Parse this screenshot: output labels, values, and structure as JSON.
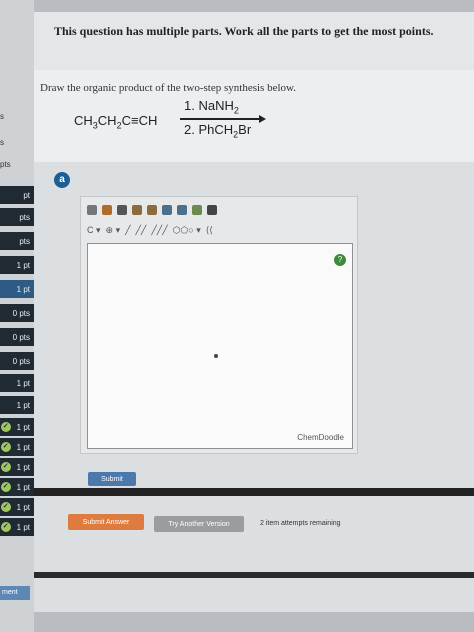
{
  "header": {
    "title": "This question has multiple parts. Work all the parts to get the most points."
  },
  "question": {
    "prompt": "Draw the organic product of the two-step synthesis below.",
    "reactant": "CH3CH2C≡CH",
    "step1": "1. NaNH2",
    "step2": "2. PhCH2Br"
  },
  "part": {
    "label": "a"
  },
  "editor": {
    "brand": "ChemDoodle",
    "submit_label": "Submit"
  },
  "actions": {
    "submit_answer_label": "Submit Answer",
    "try_version_label": "Try Another Version",
    "attempts_text": "2 item attempts remaining"
  },
  "sidebar": {
    "items": [
      "pt",
      "pts",
      "pts",
      "1 pt",
      "1 pt",
      "0 pts",
      "0 pts",
      "0 pts",
      "1 pt",
      "1 pt",
      "1 pt",
      "1 pt",
      "1 pt",
      "1 pt",
      "1 pt",
      "1 pt"
    ],
    "labels": [
      "s",
      "s",
      "pts"
    ],
    "bottom_label": "ment"
  },
  "colors": {
    "accent_blue": "#1b5e95",
    "submit_blue": "#4c79ab",
    "answer_orange": "#de7b3e",
    "check_green": "#9ec85f"
  }
}
